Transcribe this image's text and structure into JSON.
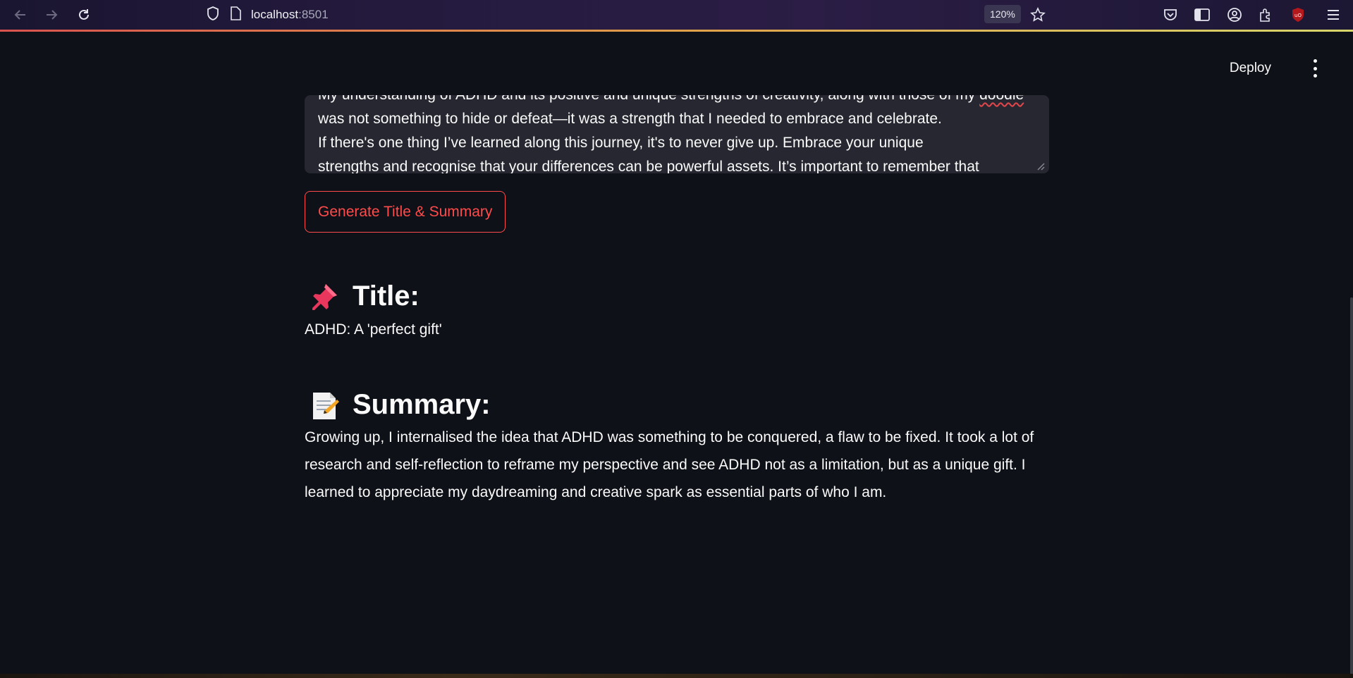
{
  "browser": {
    "url_host": "localhost",
    "url_port": ":8501",
    "zoom": "120%"
  },
  "header": {
    "deploy_label": "Deploy"
  },
  "textarea": {
    "lines": [
      "My understanding of ADHD and its positive and unique strengths of creativity, along with those of my ",
      "was not something to hide or defeat—it was a strength that I needed to embrace and celebrate.",
      "If there's one thing I’ve learned along this journey, it's to never give up. Embrace your unique",
      "strengths and recognise that your differences can be powerful assets. It’s important to remember that"
    ],
    "partial_misspelled": "doodle",
    "line4_pre": "strengths and ",
    "line4_misspelled": "recognise",
    "line4_post": " that your differences can be powerful assets. It’s important to remember that"
  },
  "actions": {
    "generate_label": "Generate Title & Summary"
  },
  "title_section": {
    "heading": "Title:",
    "icon": "pushpin-icon",
    "value": "ADHD: A 'perfect gift'"
  },
  "summary_section": {
    "heading": "Summary:",
    "icon": "memo-icon",
    "text": "Growing up, I internalised the idea that ADHD was something to be conquered, a flaw to be fixed. It took a lot of research and self-reflection to reframe my perspective and see ADHD not as a limitation, but as a unique gift. I learned to appreciate my daydreaming and creative spark as essential parts of who I am."
  },
  "colors": {
    "background": "#0e1117",
    "accent": "#ff4b4b",
    "input_bg": "#262730"
  }
}
